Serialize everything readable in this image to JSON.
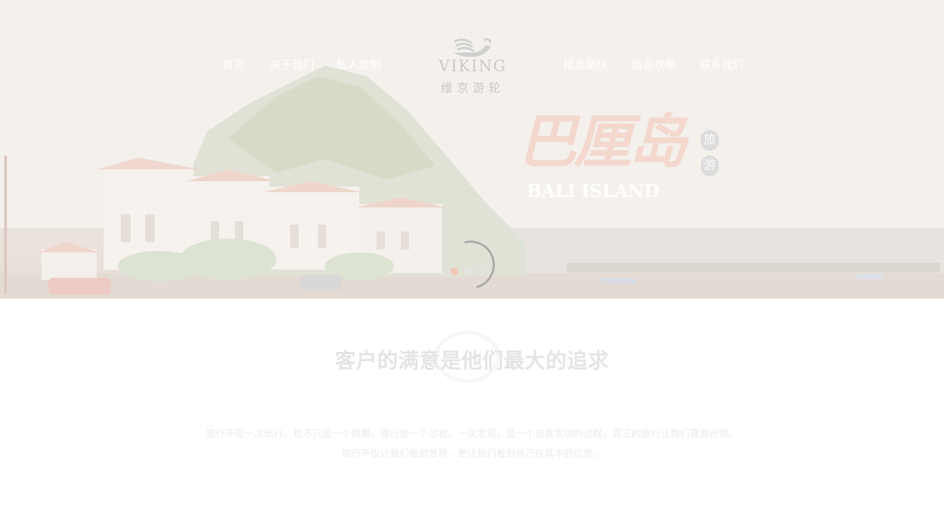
{
  "nav": {
    "left": [
      "首页",
      "关于我们",
      "私人定制"
    ],
    "right": [
      "精选路线",
      "旅游攻略",
      "联系我们"
    ]
  },
  "logo": {
    "en": "VIKING",
    "cn": "维京游轮"
  },
  "banner": {
    "title_cn": "巴厘岛",
    "seal": [
      "旅",
      "游"
    ],
    "title_en": "BALI ISLAND",
    "slides": 3,
    "active_slide": 1
  },
  "section": {
    "title": "客户的满意是他们最大的追求",
    "desc_line1": "旅行不是一次出行，也不只是一个假期，旅行是一个过程，一次发现，是一个自我发现的过程。真正的旅行让我们直面自我。",
    "desc_line2": "旅行不仅让我们看到世界，更让我们看到自己在其中的位置。"
  },
  "colors": {
    "accent": "#f2c6b6",
    "loader": "#a9a9a9"
  },
  "icons": {
    "logo": "viking-ship-icon",
    "loader": "loading-spinner-icon"
  }
}
